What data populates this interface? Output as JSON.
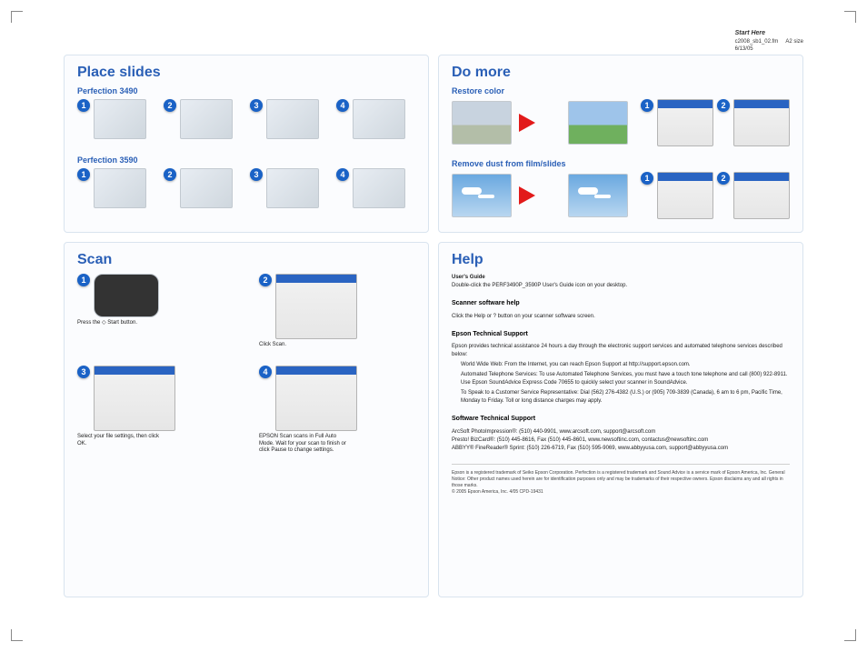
{
  "meta": {
    "title": "Start Here",
    "file": "c2008_sb1_02.fm",
    "size": "A2 size",
    "date": "6/13/05"
  },
  "placeSlides": {
    "title": "Place slides",
    "model_a": "Perfection 3490",
    "model_b": "Perfection 3590",
    "nums": {
      "n1": "1",
      "n2": "2",
      "n3": "3",
      "n4": "4"
    }
  },
  "doMore": {
    "title": "Do more",
    "restore": "Restore color",
    "remove_dust": "Remove dust from film/slides",
    "nums": {
      "n1": "1",
      "n2": "2"
    }
  },
  "scan": {
    "title": "Scan",
    "nums": {
      "n1": "1",
      "n2": "2",
      "n3": "3",
      "n4": "4"
    },
    "step1": "Press the ◇ Start button.",
    "step2": "Click Scan.",
    "step3": "Select your file settings, then click OK.",
    "step4": "EPSON Scan scans in Full Auto Mode. Wait for your scan to finish or click Pause to change settings."
  },
  "help": {
    "title": "Help",
    "ug_head": "User's Guide",
    "ug_body": "Double-click the PERF3490P_3590P User's Guide icon on your desktop.",
    "sw_head": "Scanner software help",
    "sw_body": "Click the Help or ? button on your scanner software screen.",
    "epson_head": "Epson Technical Support",
    "epson_intro": "Epson provides technical assistance 24 hours a day through the electronic support services and automated telephone services described below:",
    "www": "World Wide Web: From the Internet, you can reach Epson Support at http://support.epson.com.",
    "ats": "Automated Telephone Services: To use Automated Telephone Services, you must have a touch tone telephone and call (800) 922-8911. Use Epson SoundAdvice Express Code 70655 to quickly select your scanner in SoundAdvice.",
    "rep": "To Speak to a Customer Service Representative: Dial (562) 276-4382 (U.S.) or (905) 709-3839 (Canada), 6 am to 6 pm, Pacific Time, Monday to Friday. Toll or long distance charges may apply.",
    "soft_head": "Software Technical Support",
    "arcsoft": "ArcSoft PhotoImpression®: (510) 440-9901, www.arcsoft.com, support@arcsoft.com",
    "presto": "Presto! BizCard®: (510) 445-8616, Fax (510) 445-8601, www.newsoftinc.com, contactus@newsoftinc.com",
    "abbyy": "ABBYY® FineReader® Sprint: (510) 226-6719, Fax (510) 595-9069, www.abbyyusa.com, support@abbyyusa.com",
    "legal1": "Epson is a registered trademark of Seiko Epson Corporation. Perfection is a registered trademark and Sound Advice is a service mark of Epson America, Inc. General Notice: Other product names used herein are for identification purposes only and may be trademarks of their respective owners. Epson disclaims any and all rights in those marks.",
    "legal2": "© 2005 Epson America, Inc. 4/05 CPD-19431"
  }
}
